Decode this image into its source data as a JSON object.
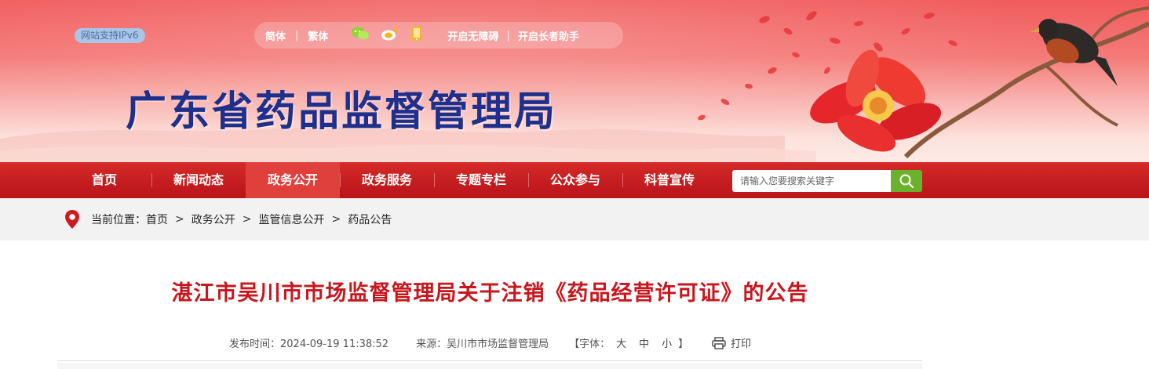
{
  "header": {
    "ipv6_badge": "网站支持IPv6",
    "lang_simplified": "简体",
    "lang_traditional": "繁体",
    "accessibility": "开启无障碍",
    "elder_assist": "开启长者助手",
    "site_title": "广东省药品监督管理局",
    "icons": [
      "wechat-icon",
      "weibo-icon",
      "mobile-icon"
    ]
  },
  "nav": {
    "items": [
      "首页",
      "新闻动态",
      "政务公开",
      "政务服务",
      "专题专栏",
      "公众参与",
      "科普宣传"
    ],
    "active_index": 2,
    "search_placeholder": "请输入您要搜索关键字"
  },
  "breadcrumb": {
    "prefix": "当前位置：",
    "items": [
      "首页",
      "政务公开",
      "监管信息公开",
      "药品公告"
    ],
    "separator": ">"
  },
  "article": {
    "title": "湛江市吴川市市场监督管理局关于注销《药品经营许可证》的公告",
    "publish_time": "发布时间：2024-09-19 11:38:52",
    "source": "来源：吴川市市场监督管理局",
    "font_label_open": "【字体：",
    "font_large": "大",
    "font_medium": "中",
    "font_small": "小",
    "font_label_close": "】",
    "print": "打印"
  },
  "colors": {
    "nav_red": "#c41c1e",
    "title_red": "#c8161d",
    "site_title_blue": "#1f2f8c",
    "search_green": "#6bb22c"
  }
}
